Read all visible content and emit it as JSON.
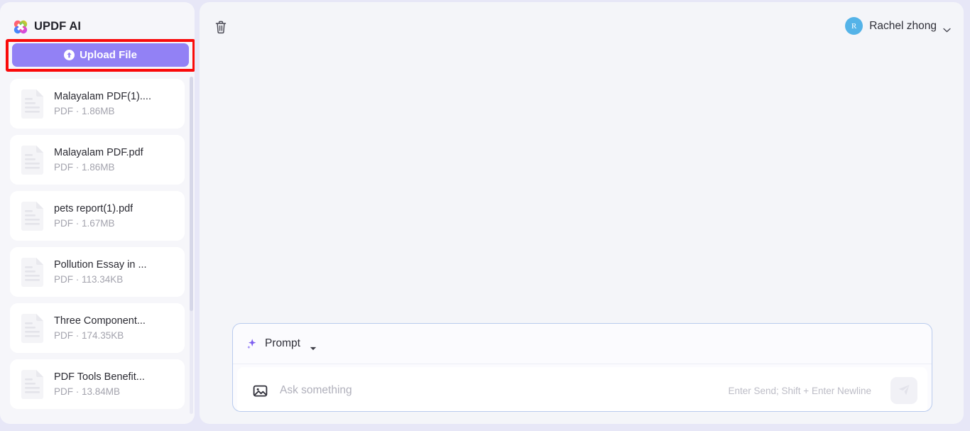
{
  "app": {
    "brand_name": "UPDF AI",
    "logo_icon": "updf-clover-logo"
  },
  "sidebar": {
    "upload_button": {
      "label": "Upload File",
      "icon": "upload-arrow-circle-icon",
      "background_color": "#9281f5",
      "highlight_color": "#fa0a0a"
    },
    "files": [
      {
        "name": "Malayalam PDF(1)....",
        "type": "PDF",
        "size": "1.86MB",
        "meta": "PDF · 1.86MB",
        "icon": "document-icon"
      },
      {
        "name": "Malayalam PDF.pdf",
        "type": "PDF",
        "size": "1.86MB",
        "meta": "PDF · 1.86MB",
        "icon": "document-icon"
      },
      {
        "name": "pets report(1).pdf",
        "type": "PDF",
        "size": "1.67MB",
        "meta": "PDF · 1.67MB",
        "icon": "document-icon"
      },
      {
        "name": "Pollution Essay in ...",
        "type": "PDF",
        "size": "113.34KB",
        "meta": "PDF · 113.34KB",
        "icon": "document-icon"
      },
      {
        "name": "Three Component...",
        "type": "PDF",
        "size": "174.35KB",
        "meta": "PDF · 174.35KB",
        "icon": "document-icon"
      },
      {
        "name": "PDF Tools Benefit...",
        "type": "PDF",
        "size": "13.84MB",
        "meta": "PDF · 13.84MB",
        "icon": "document-icon"
      }
    ]
  },
  "main": {
    "toolbar": {
      "delete_icon": "trash-icon"
    },
    "account": {
      "name": "Rachel zhong",
      "avatar_initial": "R",
      "avatar_color": "#54b3e8",
      "dropdown_icon": "chevron-down-icon"
    },
    "prompt": {
      "label": "Prompt",
      "sparkle_icon": "sparkle-icon",
      "dropdown_icon": "chevron-down-icon",
      "attach_icon": "image-icon",
      "input_value": "",
      "placeholder": "Ask something",
      "send_hint": "Enter Send; Shift + Enter Newline",
      "send_icon": "send-plane-icon"
    }
  }
}
